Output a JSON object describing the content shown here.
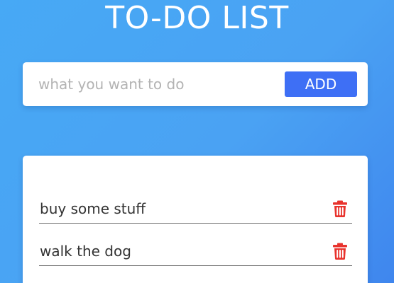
{
  "header": {
    "title": "TO-DO LIST"
  },
  "form": {
    "input_value": "",
    "input_placeholder": "what you want to do",
    "add_label": "ADD"
  },
  "todos": [
    {
      "text": "buy some stuff",
      "icon": "trash-icon"
    },
    {
      "text": "walk the dog",
      "icon": "trash-icon"
    }
  ],
  "colors": {
    "accent": "#3e6ff5",
    "delete": "#e8332d",
    "background_gradient_start": "#47a9f5",
    "background_gradient_end": "#3f86ee"
  }
}
